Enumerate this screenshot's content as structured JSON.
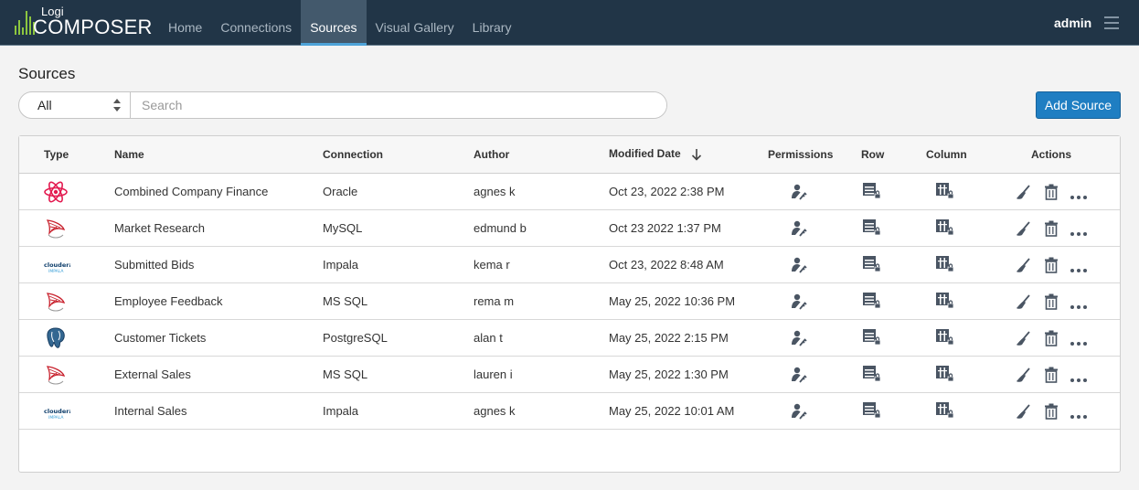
{
  "app": {
    "logo_small": "Logi",
    "logo_big": "COMPOSER"
  },
  "nav": [
    {
      "label": "Home",
      "active": false
    },
    {
      "label": "Connections",
      "active": false
    },
    {
      "label": "Sources",
      "active": true
    },
    {
      "label": "Visual Gallery",
      "active": false
    },
    {
      "label": "Library",
      "active": false
    }
  ],
  "user": {
    "name": "admin"
  },
  "page": {
    "title": "Sources"
  },
  "filter": {
    "value": "All"
  },
  "search": {
    "placeholder": "Search"
  },
  "add_button": {
    "label": "Add Source"
  },
  "table": {
    "headers": {
      "type": "Type",
      "name": "Name",
      "connection": "Connection",
      "author": "Author",
      "modified": "Modified Date",
      "permissions": "Permissions",
      "row": "Row",
      "column": "Column",
      "actions": "Actions"
    },
    "sort": {
      "column": "Modified Date",
      "direction": "descending"
    },
    "rows": [
      {
        "icon": "react-atom-icon",
        "name": "Combined Company Finance",
        "connection": "Oracle",
        "author": "agnes k",
        "modified": "Oct 23, 2022 2:38 PM"
      },
      {
        "icon": "sql-server-icon",
        "name": "Market Research",
        "connection": "MySQL",
        "author": "edmund b",
        "modified": "Oct 23 2022 1:37 PM"
      },
      {
        "icon": "cloudera-impala-icon",
        "name": "Submitted Bids",
        "connection": "Impala",
        "author": "kema r",
        "modified": "Oct 23, 2022 8:48 AM"
      },
      {
        "icon": "sql-server-icon",
        "name": "Employee Feedback",
        "connection": "MS SQL",
        "author": "rema m",
        "modified": "May 25, 2022 10:36 PM"
      },
      {
        "icon": "postgresql-icon",
        "name": "Customer Tickets",
        "connection": "PostgreSQL",
        "author": "alan t",
        "modified": "May 25, 2022 2:15 PM"
      },
      {
        "icon": "sql-server-icon",
        "name": "External Sales",
        "connection": "MS SQL",
        "author": "lauren i",
        "modified": "May 25, 2022 1:30 PM"
      },
      {
        "icon": "cloudera-impala-icon",
        "name": "Internal Sales",
        "connection": "Impala",
        "author": "agnes k",
        "modified": "May 25, 2022 10:01 AM"
      }
    ]
  },
  "colors": {
    "topbar": "#213547",
    "accent": "#1f7ec2",
    "active_tab": "#43596c",
    "logo_green": "#8cc63f"
  }
}
